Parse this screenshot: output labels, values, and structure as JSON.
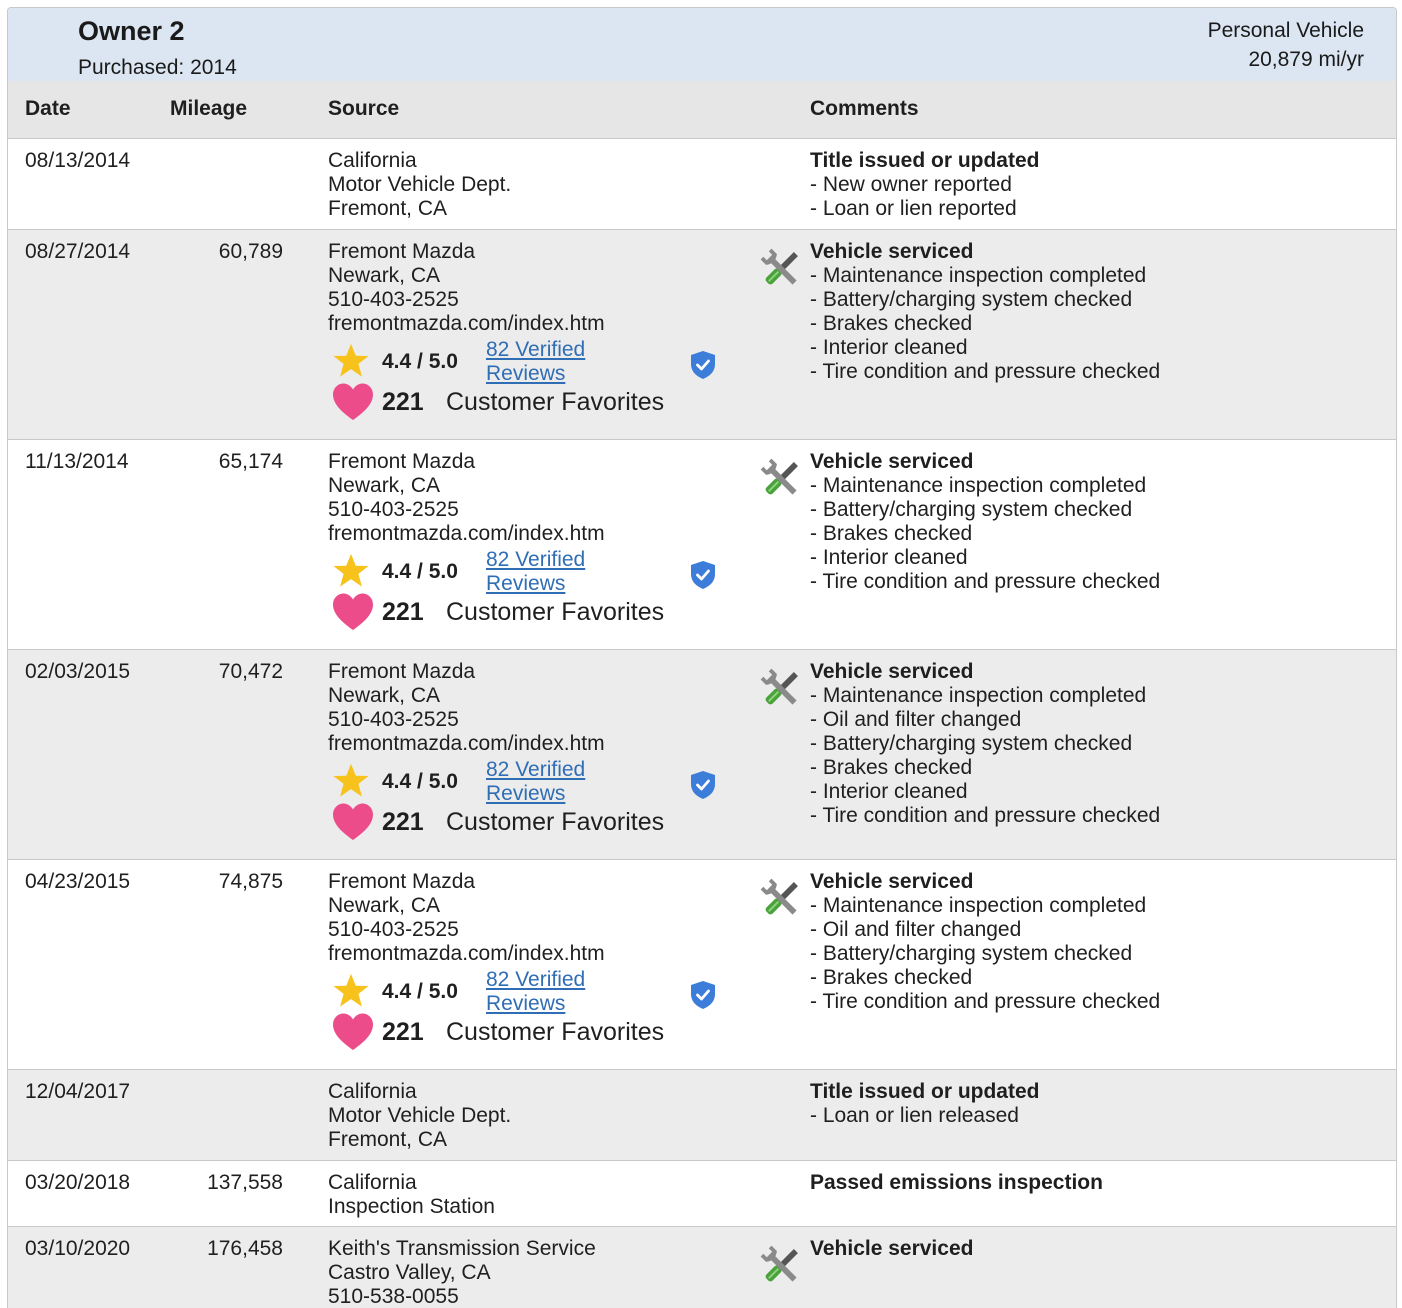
{
  "owner": {
    "title": "Owner 2",
    "purchased": "Purchased: 2014",
    "use_type": "Personal Vehicle",
    "miles_per_year": "20,879 mi/yr"
  },
  "columns": {
    "date": "Date",
    "mileage": "Mileage",
    "source": "Source",
    "comments": "Comments"
  },
  "rating": {
    "score": "4.4 / 5.0",
    "reviews_line1": "82 Verified",
    "reviews_line2": "Reviews",
    "fav_count": "221",
    "fav_label": "Customer Favorites"
  },
  "records": [
    {
      "date": "08/13/2014",
      "mileage": "",
      "source": [
        "California",
        "Motor Vehicle Dept.",
        "Fremont, CA"
      ],
      "comment_title": "Title issued or updated",
      "comment_items": [
        "- New owner reported",
        "- Loan or lien reported"
      ]
    },
    {
      "date": "08/27/2014",
      "mileage": "60,789",
      "source": [
        "Fremont Mazda",
        "Newark, CA",
        "510-403-2525",
        "fremontmazda.com/index.htm"
      ],
      "comment_title": "Vehicle serviced",
      "comment_items": [
        "- Maintenance inspection completed",
        "- Battery/charging system checked",
        "- Brakes checked",
        "- Interior cleaned",
        "- Tire condition and pressure checked"
      ]
    },
    {
      "date": "11/13/2014",
      "mileage": "65,174",
      "source": [
        "Fremont Mazda",
        "Newark, CA",
        "510-403-2525",
        "fremontmazda.com/index.htm"
      ],
      "comment_title": "Vehicle serviced",
      "comment_items": [
        "- Maintenance inspection completed",
        "- Battery/charging system checked",
        "- Brakes checked",
        "- Interior cleaned",
        "- Tire condition and pressure checked"
      ]
    },
    {
      "date": "02/03/2015",
      "mileage": "70,472",
      "source": [
        "Fremont Mazda",
        "Newark, CA",
        "510-403-2525",
        "fremontmazda.com/index.htm"
      ],
      "comment_title": "Vehicle serviced",
      "comment_items": [
        "- Maintenance inspection completed",
        "- Oil and filter changed",
        "- Battery/charging system checked",
        "- Brakes checked",
        "- Interior cleaned",
        "- Tire condition and pressure checked"
      ]
    },
    {
      "date": "04/23/2015",
      "mileage": "74,875",
      "source": [
        "Fremont Mazda",
        "Newark, CA",
        "510-403-2525",
        "fremontmazda.com/index.htm"
      ],
      "comment_title": "Vehicle serviced",
      "comment_items": [
        "- Maintenance inspection completed",
        "- Oil and filter changed",
        "- Battery/charging system checked",
        "- Brakes checked",
        "- Tire condition and pressure checked"
      ]
    },
    {
      "date": "12/04/2017",
      "mileage": "",
      "source": [
        "California",
        "Motor Vehicle Dept.",
        "Fremont, CA"
      ],
      "comment_title": "Title issued or updated",
      "comment_items": [
        "- Loan or lien released"
      ]
    },
    {
      "date": "03/20/2018",
      "mileage": "137,558",
      "source": [
        "California",
        "Inspection Station"
      ],
      "comment_title": "Passed emissions inspection",
      "comment_items": []
    },
    {
      "date": "03/10/2020",
      "mileage": "176,458",
      "source": [
        "Keith's Transmission Service",
        "Castro Valley, CA",
        "510-538-0055"
      ],
      "comment_title": "Vehicle serviced",
      "comment_items": []
    }
  ],
  "colors": {
    "header_bg": "#dbe6f2",
    "column_header_bg": "#e6e6e6",
    "alt_row_bg": "#ececec",
    "link": "#2f6db5",
    "star": "#f7c21b",
    "heart": "#ec4d8a",
    "shield": "#3b7dd8",
    "wrench_handle": "#4aa33a"
  },
  "icons": {
    "service": "wrench-screwdriver-icon",
    "rating": "star-icon",
    "verified": "shield-check-icon",
    "favorite": "heart-icon"
  }
}
